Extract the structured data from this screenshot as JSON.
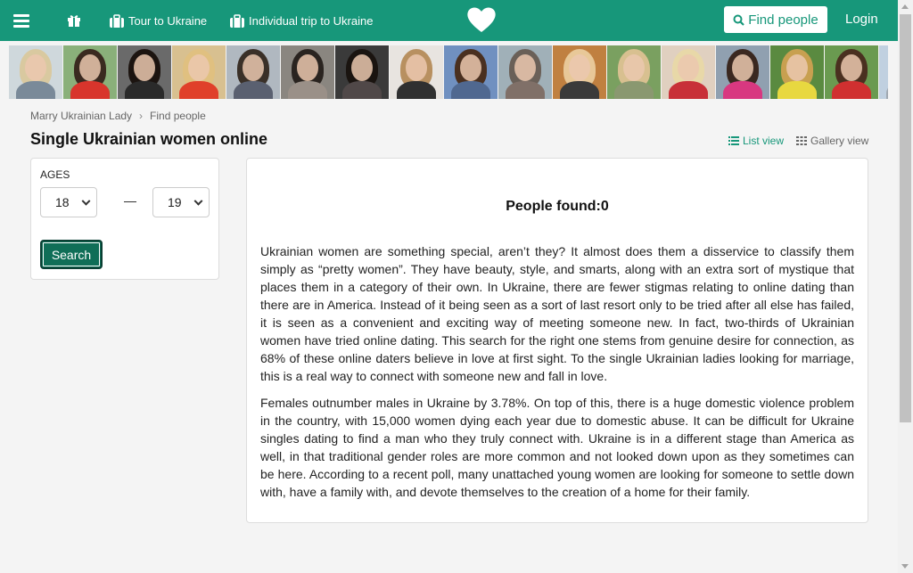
{
  "header": {
    "nav": [
      {
        "label": "Tour to Ukraine",
        "icon": "suitcase-icon"
      },
      {
        "label": "Individual trip to Ukraine",
        "icon": "suitcase-icon"
      }
    ],
    "find_label": "Find people",
    "login_label": "Login",
    "brand_color": "#17977a"
  },
  "photo_strip": [
    {
      "icon": "profile-photo",
      "bg": "#cfd8dc",
      "hair": "#d9c9a0",
      "body": "#7a8a99"
    },
    {
      "icon": "profile-photo",
      "bg": "#8ab07a",
      "hair": "#3a2a20",
      "body": "#d8352c"
    },
    {
      "icon": "profile-photo",
      "bg": "#6a6a6a",
      "hair": "#1c1410",
      "body": "#2a2a2a"
    },
    {
      "icon": "profile-photo",
      "bg": "#d8c090",
      "hair": "#e0c080",
      "body": "#e0402a"
    },
    {
      "icon": "profile-photo",
      "bg": "#b0b8c0",
      "hair": "#3a3028",
      "body": "#5a6070"
    },
    {
      "icon": "profile-photo",
      "bg": "#8a8680",
      "hair": "#2a2420",
      "body": "#9a9088"
    },
    {
      "icon": "profile-photo",
      "bg": "#3a3a3a",
      "hair": "#1a1410",
      "body": "#504848"
    },
    {
      "icon": "profile-photo",
      "bg": "#e8e4e0",
      "hair": "#b89060",
      "body": "#303030"
    },
    {
      "icon": "profile-photo",
      "bg": "#7090c0",
      "hair": "#4a3020",
      "body": "#506890"
    },
    {
      "icon": "profile-photo",
      "bg": "#a0b0b8",
      "hair": "#6a6058",
      "body": "#807068"
    },
    {
      "icon": "profile-photo",
      "bg": "#c08040",
      "hair": "#e8c898",
      "body": "#3a3a3a"
    },
    {
      "icon": "profile-photo",
      "bg": "#7aa060",
      "hair": "#d8c090",
      "body": "#8a9870"
    },
    {
      "icon": "profile-photo",
      "bg": "#e0d0c0",
      "hair": "#e8d8a8",
      "body": "#c83038"
    },
    {
      "icon": "profile-photo",
      "bg": "#90a0b0",
      "hair": "#3a2820",
      "body": "#d83880"
    },
    {
      "icon": "profile-photo",
      "bg": "#5a8a40",
      "hair": "#c8a050",
      "body": "#e8d840"
    },
    {
      "icon": "profile-photo",
      "bg": "#6a9a50",
      "hair": "#4a3020",
      "body": "#d03030"
    },
    {
      "icon": "profile-photo",
      "bg": "#c0d0e0",
      "hair": "#8a7060",
      "body": "#a0a8b0"
    }
  ],
  "breadcrumb": {
    "home": "Marry Ukrainian Lady",
    "separator": "›",
    "current": "Find people"
  },
  "page_title": "Single Ukrainian women online",
  "views": {
    "list_label": "List view",
    "gallery_label": "Gallery view"
  },
  "filter": {
    "ages_label": "AGES",
    "age_from": "18",
    "age_to": "19",
    "dash": "—",
    "search_label": "Search"
  },
  "results": {
    "found_text": "People found:0",
    "paragraphs": [
      "Ukrainian women are something special, aren’t they? It almost does them a disservice to classify them simply as “pretty women”. They have beauty, style, and smarts, along with an extra sort of mystique that places them in a category of their own. In Ukraine, there are fewer stigmas relating to online dating than there are in America. Instead of it being seen as a sort of last resort only to be tried after all else has failed, it is seen as a convenient and exciting way of meeting someone new. In fact, two-thirds of Ukrainian women have tried online dating. This search for the right one stems from genuine desire for connection, as 68% of these online daters believe in love at first sight. To the single Ukrainian ladies looking for marriage, this is a real way to connect with someone new and fall in love.",
      "Females outnumber males in Ukraine by 3.78%. On top of this, there is a huge domestic violence problem in the country, with 15,000 women dying each year due to domestic abuse. It can be difficult for Ukraine singles dating to find a man who they truly connect with. Ukraine is in a different stage than America as well, in that traditional gender roles are more common and not looked down upon as they sometimes can be here. According to a recent poll, many unattached young women are looking for someone to settle down with, have a family with, and devote themselves to the creation of a home for their family."
    ]
  }
}
